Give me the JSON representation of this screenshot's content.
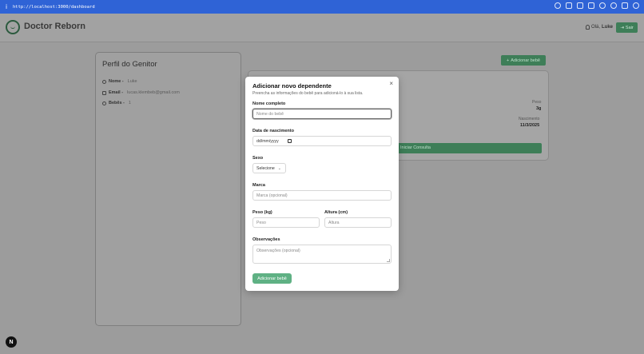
{
  "browser": {
    "info_icon": "i",
    "url": "http://localhost:3000/dashboard"
  },
  "header": {
    "brand": "Doctor Reborn",
    "greeting_prefix": "Olá,",
    "user_name": "Luke",
    "logout_label": "Sair"
  },
  "profile": {
    "title": "Perfil do Genitor",
    "name_label": "Nome -",
    "name_value": "Luke",
    "email_label": "Email -",
    "email_value": "lucas.klembeb@gmail.com",
    "babies_label": "Bebês -",
    "babies_value": "1"
  },
  "dashboard": {
    "add_baby_label": "Adicionar bebê",
    "baby_card": {
      "weight_label": "Peso",
      "weight_value": "3g",
      "birth_label": "Nascimento",
      "birth_value": "11/3/2025",
      "consult_button": "Iniciar Consulta"
    }
  },
  "modal": {
    "close": "×",
    "title": "Adicionar novo dependente",
    "description": "Preencha as informações do bebê para adicioná-lo à sua lista.",
    "full_name": {
      "label": "Nome completo",
      "placeholder": "Nome do bebê"
    },
    "birth_date": {
      "label": "Data de nascimento",
      "value": "dd/mm/yyyy"
    },
    "sex": {
      "label": "Sexo",
      "selected": "Selecione"
    },
    "brand": {
      "label": "Marca",
      "placeholder": "Marca (opcional)"
    },
    "weight": {
      "label": "Peso (kg)",
      "placeholder": "Peso"
    },
    "height": {
      "label": "Altura (cm)",
      "placeholder": "Altura"
    },
    "notes": {
      "label": "Observações",
      "placeholder": "Observações (opcional)"
    },
    "submit": "Adicionar bebê"
  },
  "dev_badge": "N",
  "colors": {
    "browser_bar": "#2f63d6",
    "accent_green": "#5fb184",
    "dark_green": "#3e7e58"
  }
}
